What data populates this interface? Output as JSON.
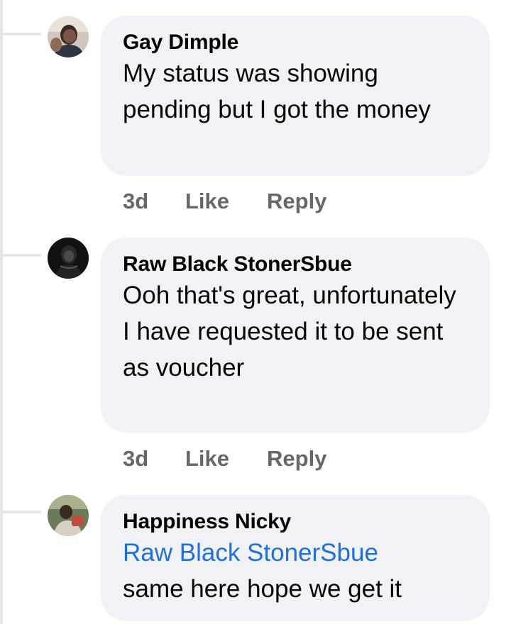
{
  "comments": [
    {
      "author": "Gay Dimple",
      "text": "My status was showing pending but I got the money",
      "time": "3d",
      "like_label": "Like",
      "reply_label": "Reply",
      "avatar": "profile-photo-woman"
    },
    {
      "author": "Raw Black StonerSbue",
      "text": "Ooh that's great, unfortunately I have requested it to be sent as voucher",
      "time": "3d",
      "like_label": "Like",
      "reply_label": "Reply",
      "avatar": "profile-photo-dark"
    },
    {
      "author": "Happiness Nicky",
      "mention": "Raw Black StonerSbue",
      "text": "same here hope we get it",
      "avatar": "profile-photo-child"
    }
  ],
  "colors": {
    "bubble": "#f0f2f5",
    "mention": "#216fdb",
    "action_text": "#65676b",
    "thread_line": "#e4e6eb"
  }
}
